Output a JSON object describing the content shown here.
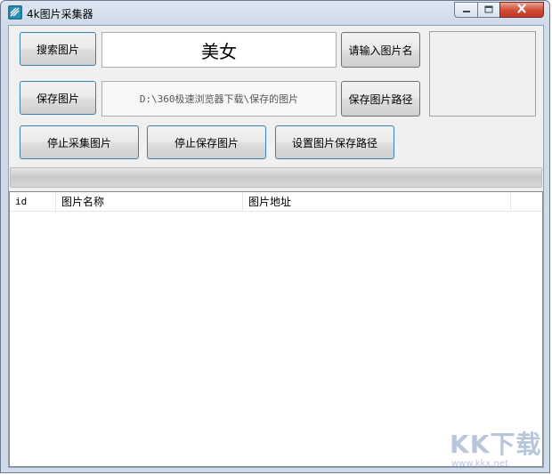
{
  "window": {
    "title": "4k图片采集器",
    "buttons": {
      "minimize": "minimize",
      "maximize": "maximize",
      "close": "close"
    }
  },
  "toolbar": {
    "search_button": "搜索图片",
    "search_value": "美女",
    "name_button": "请输入图片名",
    "save_button": "保存图片",
    "path_value": "D:\\360极速浏览器下载\\保存的图片",
    "path_button": "保存图片路径",
    "stop_collect_button": "停止采集图片",
    "stop_save_button": "停止保存图片",
    "set_path_button": "设置图片保存路径"
  },
  "progress": {
    "value": 0
  },
  "table": {
    "columns": [
      "id",
      "图片名称",
      "图片地址"
    ],
    "rows": []
  },
  "watermark": {
    "logo": "KK下载",
    "url": "www.kkx.net"
  },
  "icons": [
    "app-icon",
    "minimize-icon",
    "maximize-icon",
    "close-icon"
  ]
}
